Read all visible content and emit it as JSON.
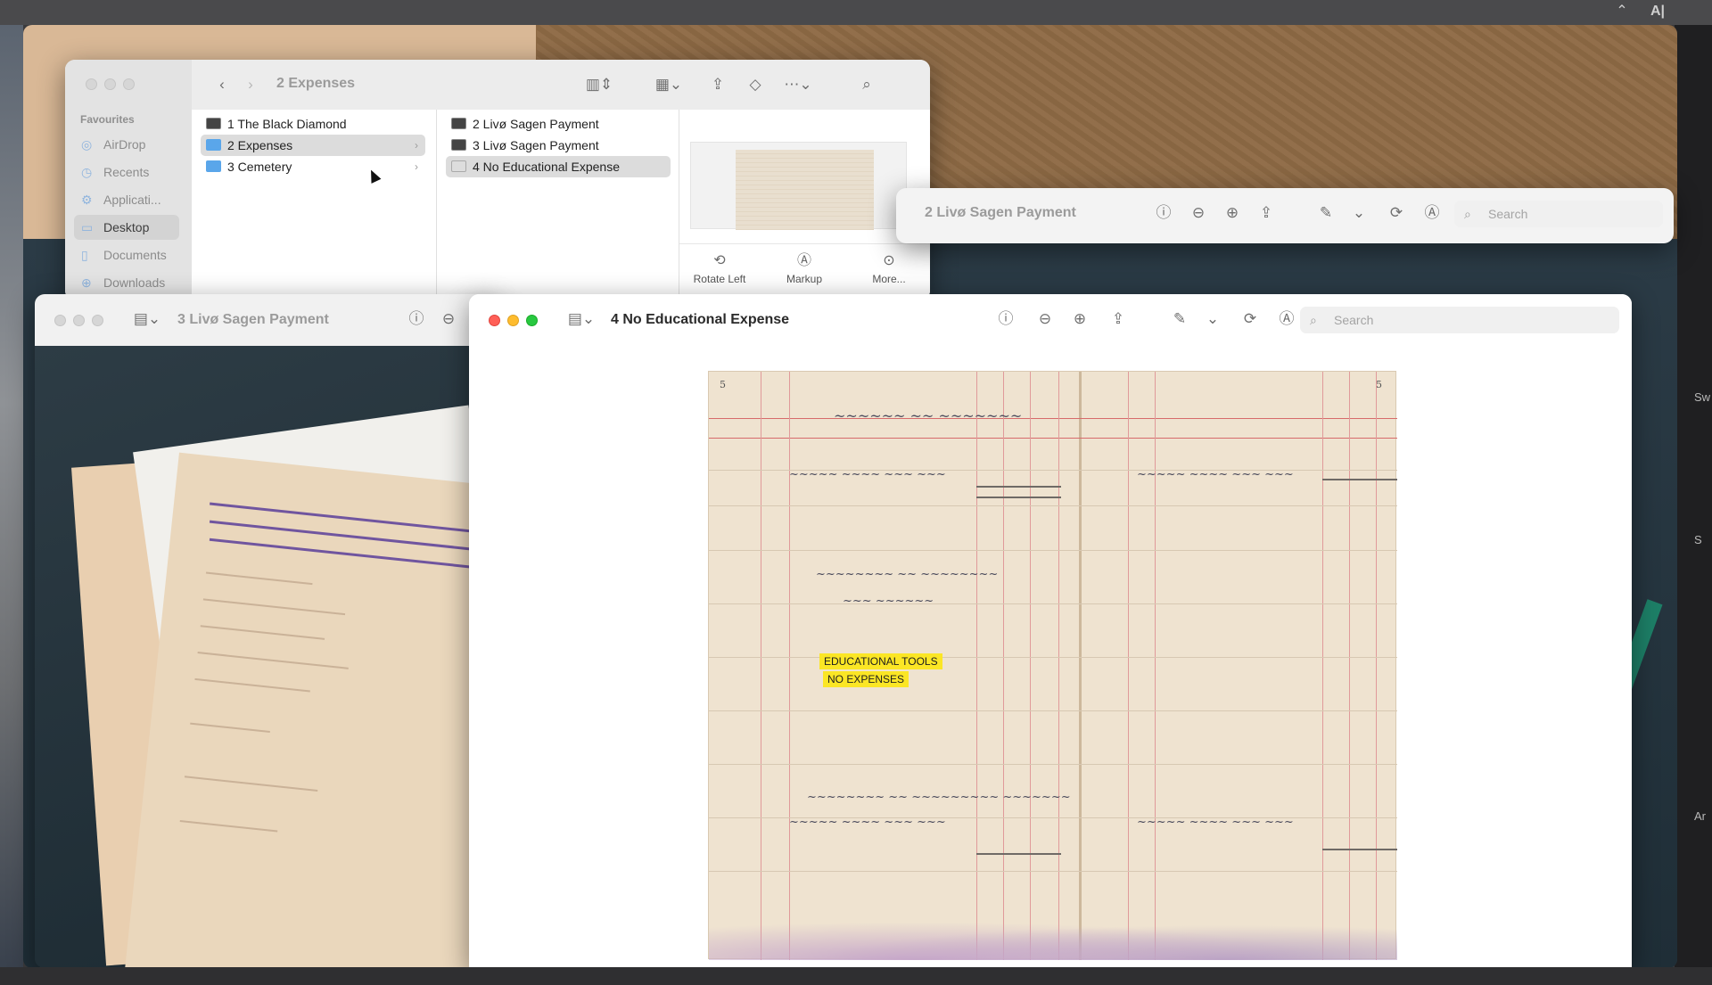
{
  "finder": {
    "title": "2 Expenses",
    "sidebar_heading": "Favourites",
    "sidebar_items": [
      {
        "label": "AirDrop",
        "icon": "airdrop-icon"
      },
      {
        "label": "Recents",
        "icon": "clock-icon"
      },
      {
        "label": "Applicati...",
        "icon": "apps-icon"
      },
      {
        "label": "Desktop",
        "icon": "desktop-icon",
        "selected": true
      },
      {
        "label": "Documents",
        "icon": "document-icon"
      },
      {
        "label": "Downloads",
        "icon": "download-icon"
      }
    ],
    "column1": [
      {
        "label": "1 The Black Diamond",
        "type": "file"
      },
      {
        "label": "2 Expenses",
        "type": "folder",
        "selected": true
      },
      {
        "label": "3 Cemetery",
        "type": "folder"
      }
    ],
    "column2": [
      {
        "label": "2 Livø Sagen Payment"
      },
      {
        "label": "3 Livø Sagen Payment"
      },
      {
        "label": "4 No Educational Expense",
        "selected": true
      }
    ],
    "preview_actions": [
      "Rotate Left",
      "Markup",
      "More..."
    ]
  },
  "preview_back": {
    "title": "2 Livø Sagen Payment",
    "search_placeholder": "Search"
  },
  "preview_mid": {
    "title": "3 Livø Sagen Payment"
  },
  "preview_front": {
    "title": "4 No Educational Expense",
    "search_placeholder": "Search",
    "page_left": "5",
    "page_right": "5",
    "highlights": [
      "EDUCATIONAL TOOLS",
      "NO EXPENSES"
    ],
    "typed_text": [
      "eller man = mulige indtil videre med de 600 Kr mod , at Staten",
      "Aarets Udløb dækker, hvad der yderligere, efter godkendt Regnsk",
      "og paa Basis af et vedtaget Budget, er medgaaet."
    ]
  },
  "colors": {
    "accent_red": "#ff5f57",
    "accent_yellow": "#febc2e",
    "accent_green": "#28c840",
    "highlight": "#fbe625",
    "folder": "#5aa6ea"
  }
}
